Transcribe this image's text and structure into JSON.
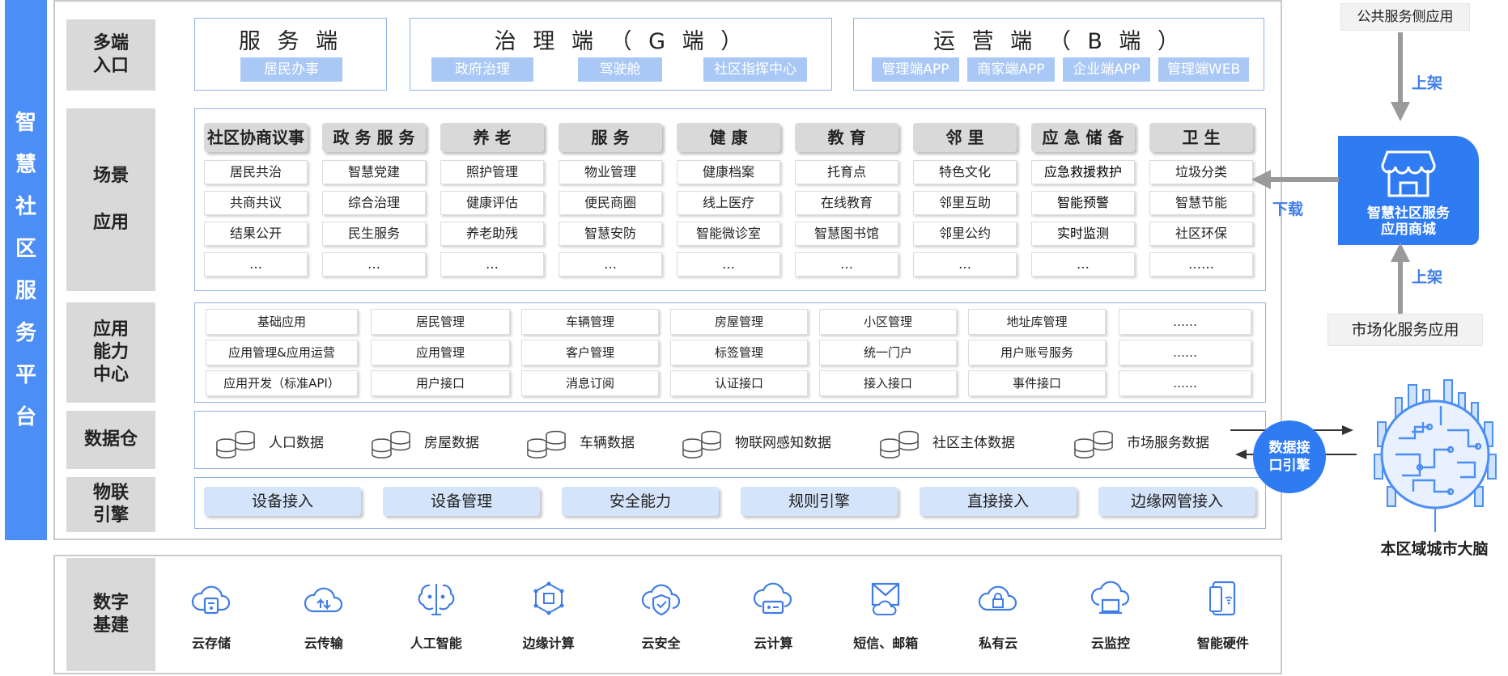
{
  "vertical_title": [
    "智",
    "慧",
    "社",
    "区",
    "服",
    "务",
    "平",
    "台"
  ],
  "rows": {
    "entry": [
      "多端",
      "入口"
    ],
    "scene": [
      "场景",
      "应用"
    ],
    "ability": [
      "应用",
      "能力",
      "中心"
    ],
    "warehouse": "数据仓",
    "iot": [
      "物联",
      "引擎"
    ],
    "base": [
      "数字",
      "基建"
    ]
  },
  "entry_groups": [
    {
      "title": "服 务 端",
      "chips": [
        "居民办事"
      ]
    },
    {
      "title": "治 理 端 （ G 端 ）",
      "chips": [
        "政府治理",
        "驾驶舱",
        "社区指挥中心"
      ]
    },
    {
      "title": "运 营 端 （ B 端 ）",
      "chips": [
        "管理端APP",
        "商家端APP",
        "企业端APP",
        "管理端WEB"
      ]
    }
  ],
  "scenes": [
    {
      "head": "社区协商议事",
      "items": [
        "居民共治",
        "共商共议",
        "结果公开",
        "…"
      ]
    },
    {
      "head": "政 务 服 务",
      "items": [
        "智慧党建",
        "综合治理",
        "民生服务",
        "…"
      ]
    },
    {
      "head": "养 老",
      "items": [
        "照护管理",
        "健康评估",
        "养老助残",
        "…"
      ]
    },
    {
      "head": "服 务",
      "items": [
        "物业管理",
        "便民商圈",
        "智慧安防",
        "…"
      ]
    },
    {
      "head": "健 康",
      "items": [
        "健康档案",
        "线上医疗",
        "智能微诊室",
        "…"
      ]
    },
    {
      "head": "教 育",
      "items": [
        "托育点",
        "在线教育",
        "智慧图书馆",
        "…"
      ]
    },
    {
      "head": "邻 里",
      "items": [
        "特色文化",
        "邻里互助",
        "邻里公约",
        "…"
      ]
    },
    {
      "head": "应 急 储 备",
      "items": [
        "应急救援救护",
        "智能预警",
        "实时监测",
        "…"
      ]
    },
    {
      "head": "卫 生",
      "items": [
        "垃圾分类",
        "智慧节能",
        "社区环保",
        "……"
      ]
    }
  ],
  "abilities": [
    [
      "基础应用",
      "居民管理",
      "车辆管理",
      "房屋管理",
      "小区管理",
      "地址库管理",
      "……"
    ],
    [
      "应用管理&应用运营",
      "应用管理",
      "客户管理",
      "标签管理",
      "统一门户",
      "用户账号服务",
      "……"
    ],
    [
      "应用开发（标准API）",
      "用户接口",
      "消息订阅",
      "认证接口",
      "接入接口",
      "事件接口",
      "……"
    ]
  ],
  "warehouse_items": [
    "人口数据",
    "房屋数据",
    "车辆数据",
    "物联网感知数据",
    "社区主体数据",
    "市场服务数据"
  ],
  "iot_items": [
    "设备接入",
    "设备管理",
    "安全能力",
    "规则引擎",
    "直接接入",
    "边缘网管接入"
  ],
  "base_items": [
    {
      "label": "云存储",
      "icon": "cloud-storage-icon"
    },
    {
      "label": "云传输",
      "icon": "cloud-transfer-icon"
    },
    {
      "label": "人工智能",
      "icon": "brain-icon"
    },
    {
      "label": "边缘计算",
      "icon": "edge-compute-icon"
    },
    {
      "label": "云安全",
      "icon": "cloud-shield-icon"
    },
    {
      "label": "云计算",
      "icon": "cloud-compute-icon"
    },
    {
      "label": "短信、邮箱",
      "icon": "mail-icon"
    },
    {
      "label": "私有云",
      "icon": "cloud-lock-icon"
    },
    {
      "label": "云监控",
      "icon": "cloud-monitor-icon"
    },
    {
      "label": "智能硬件",
      "icon": "smart-hardware-icon"
    }
  ],
  "right": {
    "public_app": "公共服务侧应用",
    "up_top": "上架",
    "download": "下载",
    "store": [
      "智慧社区服务",
      "应用商城"
    ],
    "up_bottom": "上架",
    "market_app": "市场化服务应用",
    "engine": [
      "数据接",
      "口引擎"
    ],
    "city_brain": "本区域城市大脑"
  },
  "colors": {
    "primary": "#4b8ef5",
    "store": "#2f7bf2",
    "chip": "#a9c8f5",
    "iot": "#d4e4fa",
    "label_grey": "#d9d9d9"
  }
}
